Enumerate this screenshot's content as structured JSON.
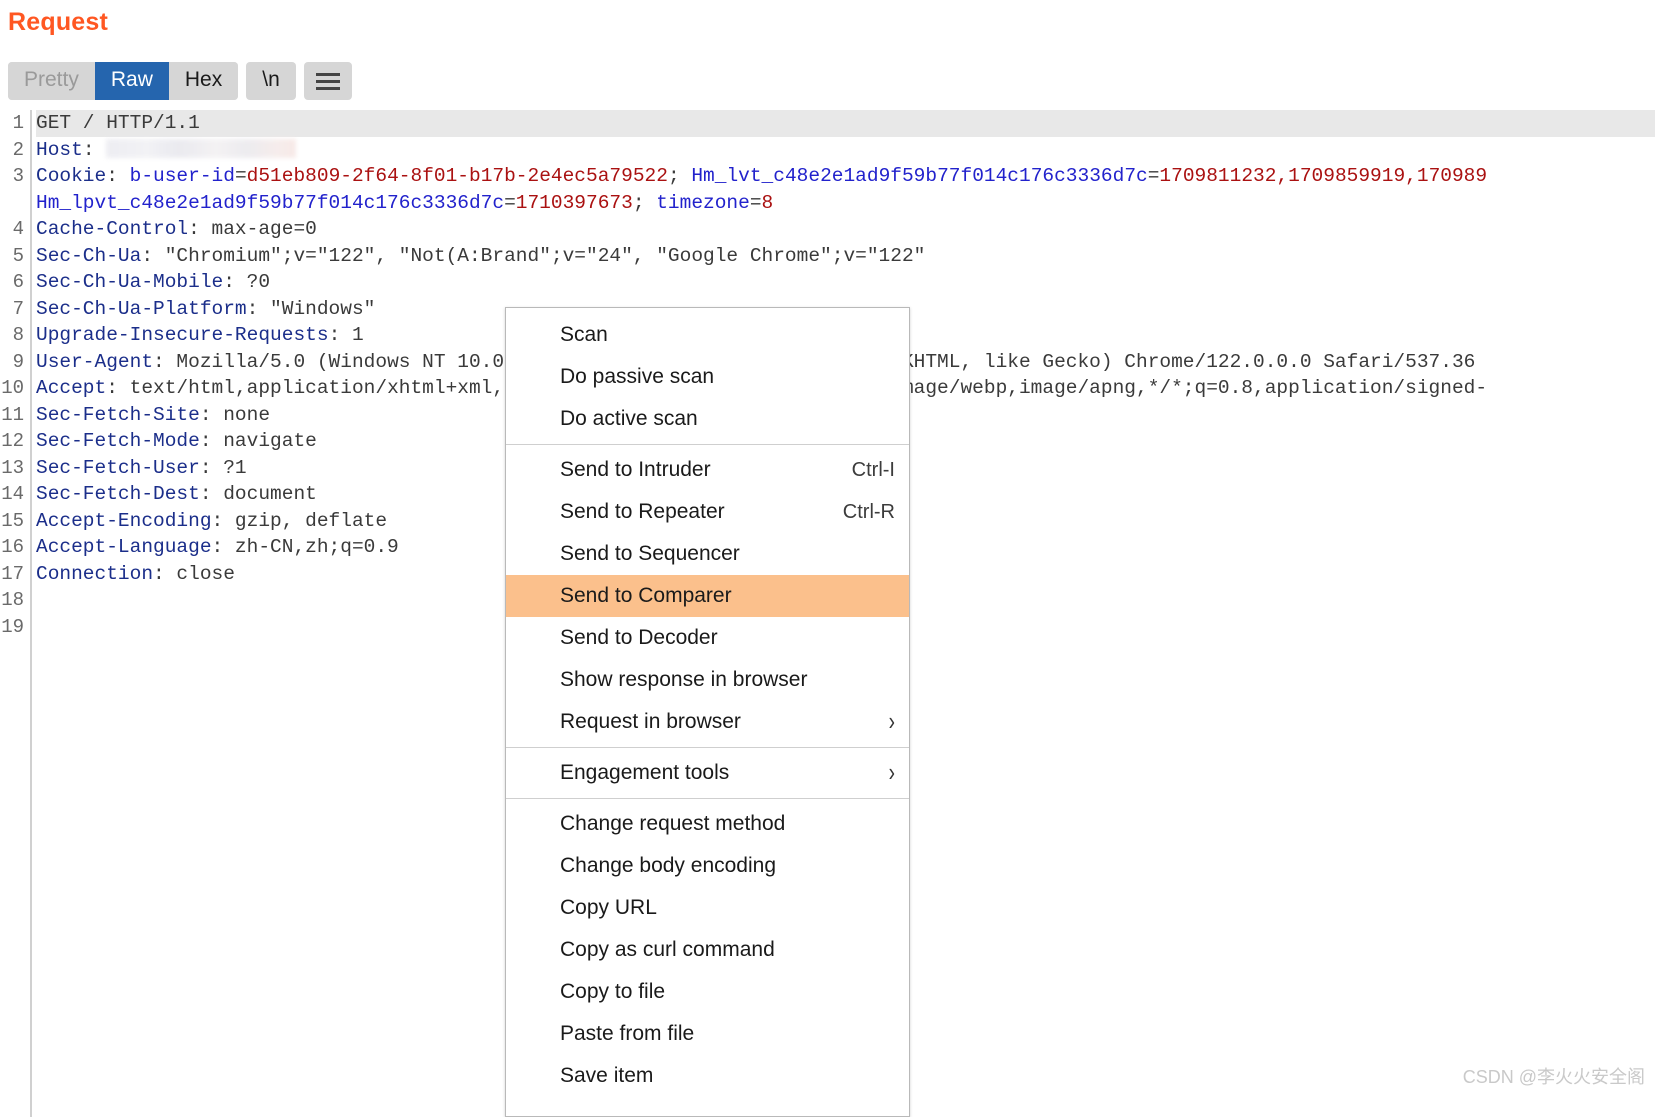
{
  "panel": {
    "title": "Request"
  },
  "toolbar": {
    "pretty_label": "Pretty",
    "raw_label": "Raw",
    "hex_label": "Hex",
    "newline_label": "\\n",
    "menu_icon": "hamburger-icon",
    "active_view": "Raw"
  },
  "editor": {
    "line_numbers": [
      "1",
      "2",
      "3",
      "4",
      "5",
      "6",
      "7",
      "8",
      "9",
      "10",
      "11",
      "12",
      "13",
      "14",
      "15",
      "16",
      "17",
      "18",
      "19"
    ],
    "lines": [
      {
        "num": "1",
        "header": "",
        "text": "GET / HTTP/1.1",
        "type": "request-line"
      },
      {
        "num": "2",
        "header": "Host",
        "value": "",
        "type": "redacted"
      },
      {
        "num": "3",
        "header": "Cookie",
        "type": "cookie",
        "cookies": [
          {
            "name": "b-user-id",
            "value": "d51eb809-2f64-8f01-b17b-2e4ec5a79522"
          },
          {
            "name": "Hm_lvt_c48e2e1ad9f59b77f014c176c3336d7c",
            "value": "1709811232,1709859919,170989"
          },
          {
            "name": "Hm_lpvt_c48e2e1ad9f59b77f014c176c3336d7c",
            "value": "1710397673"
          },
          {
            "name": "timezone",
            "value": "8"
          }
        ]
      },
      {
        "num": "4",
        "header": "Cache-Control",
        "value": "max-age=0",
        "type": "header"
      },
      {
        "num": "5",
        "header": "Sec-Ch-Ua",
        "value": "\"Chromium\";v=\"122\", \"Not(A:Brand\";v=\"24\", \"Google Chrome\";v=\"122\"",
        "type": "header"
      },
      {
        "num": "6",
        "header": "Sec-Ch-Ua-Mobile",
        "value": "?0",
        "type": "header"
      },
      {
        "num": "7",
        "header": "Sec-Ch-Ua-Platform",
        "value": "\"Windows\"",
        "type": "header"
      },
      {
        "num": "8",
        "header": "Upgrade-Insecure-Requests",
        "value": "1",
        "type": "header"
      },
      {
        "num": "9",
        "header": "User-Agent",
        "value": "Mozilla/5.0 (Windows NT 10.0; Win64; x64) AppleWebKit/537.36 (KHTML, like Gecko) Chrome/122.0.0.0 Safari/537.36",
        "type": "header"
      },
      {
        "num": "10",
        "header": "Accept",
        "value": "text/html,application/xhtml+xml,application/xml;q=0.9,image/avif,image/webp,image/apng,*/*;q=0.8,application/signed-",
        "type": "header"
      },
      {
        "num": "11",
        "header": "Sec-Fetch-Site",
        "value": "none",
        "type": "header"
      },
      {
        "num": "12",
        "header": "Sec-Fetch-Mode",
        "value": "navigate",
        "type": "header"
      },
      {
        "num": "13",
        "header": "Sec-Fetch-User",
        "value": "?1",
        "type": "header"
      },
      {
        "num": "14",
        "header": "Sec-Fetch-Dest",
        "value": "document",
        "type": "header"
      },
      {
        "num": "15",
        "header": "Accept-Encoding",
        "value": "gzip, deflate",
        "type": "header"
      },
      {
        "num": "16",
        "header": "Accept-Language",
        "value": "zh-CN,zh;q=0.9",
        "type": "header"
      },
      {
        "num": "17",
        "header": "Connection",
        "value": "close",
        "type": "header"
      },
      {
        "num": "18",
        "header": "",
        "value": "",
        "type": "blank"
      },
      {
        "num": "19",
        "header": "",
        "value": "",
        "type": "blank"
      }
    ]
  },
  "context_menu": {
    "highlighted_item": "Send to Comparer",
    "items": [
      {
        "label": "Scan",
        "accel": "",
        "submenu": false
      },
      {
        "label": "Do passive scan",
        "accel": "",
        "submenu": false
      },
      {
        "label": "Do active scan",
        "accel": "",
        "submenu": false
      },
      {
        "separator": true
      },
      {
        "label": "Send to Intruder",
        "accel": "Ctrl-I",
        "submenu": false
      },
      {
        "label": "Send to Repeater",
        "accel": "Ctrl-R",
        "submenu": false
      },
      {
        "label": "Send to Sequencer",
        "accel": "",
        "submenu": false
      },
      {
        "label": "Send to Comparer",
        "accel": "",
        "submenu": false,
        "highlight": true
      },
      {
        "label": "Send to Decoder",
        "accel": "",
        "submenu": false
      },
      {
        "label": "Show response in browser",
        "accel": "",
        "submenu": false
      },
      {
        "label": "Request in browser",
        "accel": "",
        "submenu": true
      },
      {
        "separator": true
      },
      {
        "label": "Engagement tools",
        "accel": "",
        "submenu": true
      },
      {
        "separator": true
      },
      {
        "label": "Change request method",
        "accel": "",
        "submenu": false
      },
      {
        "label": "Change body encoding",
        "accel": "",
        "submenu": false
      },
      {
        "label": "Copy URL",
        "accel": "",
        "submenu": false
      },
      {
        "label": "Copy as curl command",
        "accel": "",
        "submenu": false
      },
      {
        "label": "Copy to file",
        "accel": "",
        "submenu": false
      },
      {
        "label": "Paste from file",
        "accel": "",
        "submenu": false
      },
      {
        "label": "Save item",
        "accel": "",
        "submenu": false
      }
    ]
  },
  "watermark": {
    "text": "CSDN @李火火安全阁"
  },
  "colors": {
    "accent": "#ff5722",
    "active_tab": "#2565ae",
    "highlight": "#fbc08c",
    "header_name": "#1b2e8a",
    "cookie_name": "#2222cc",
    "cookie_value": "#aa1111"
  }
}
